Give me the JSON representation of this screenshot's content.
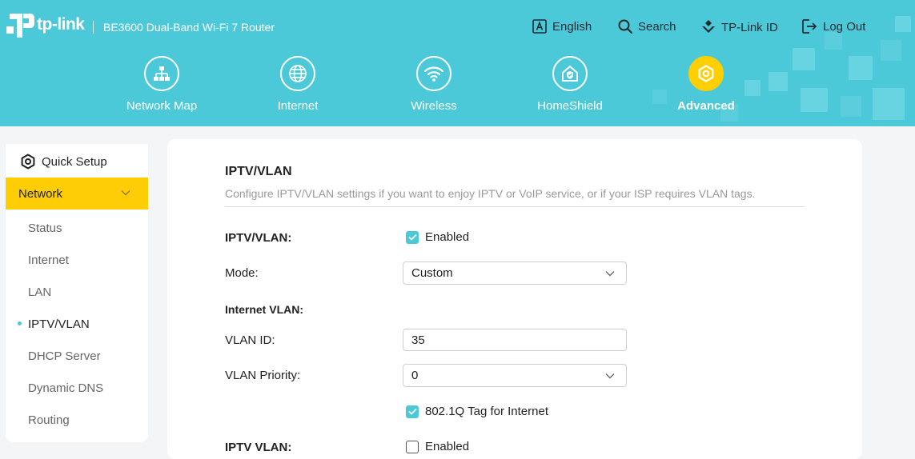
{
  "header": {
    "brand": "tp-link",
    "model": "BE3600 Dual-Band Wi-Fi 7 Router",
    "top_nav": {
      "language": "English",
      "search": "Search",
      "tplink_id": "TP-Link ID",
      "logout": "Log Out"
    },
    "main_nav": {
      "network_map": "Network Map",
      "internet": "Internet",
      "wireless": "Wireless",
      "homeshield": "HomeShield",
      "advanced": "Advanced"
    },
    "colors": {
      "header_bg": "#4cc9d9",
      "accent_yellow": "#ffcf00"
    }
  },
  "sidebar": {
    "quick_setup": "Quick Setup",
    "section": "Network",
    "items": [
      "Status",
      "Internet",
      "LAN",
      "IPTV/VLAN",
      "DHCP Server",
      "Dynamic DNS",
      "Routing"
    ],
    "active_item": "IPTV/VLAN"
  },
  "content": {
    "title": "IPTV/VLAN",
    "description": "Configure IPTV/VLAN settings if you want to enjoy IPTV or VoIP service, or if your ISP requires VLAN tags.",
    "iptv_vlan_label": "IPTV/VLAN:",
    "iptv_vlan_enabled_text": "Enabled",
    "mode_label": "Mode:",
    "mode_value": "Custom",
    "internet_vlan_heading": "Internet VLAN:",
    "vlan_id_label": "VLAN ID:",
    "vlan_id_value": "35",
    "vlan_priority_label": "VLAN Priority:",
    "vlan_priority_value": "0",
    "tag_internet_text": "802.1Q Tag for Internet",
    "iptv_vlan2_label": "IPTV VLAN:",
    "iptv_vlan2_enabled_text": "Enabled"
  }
}
